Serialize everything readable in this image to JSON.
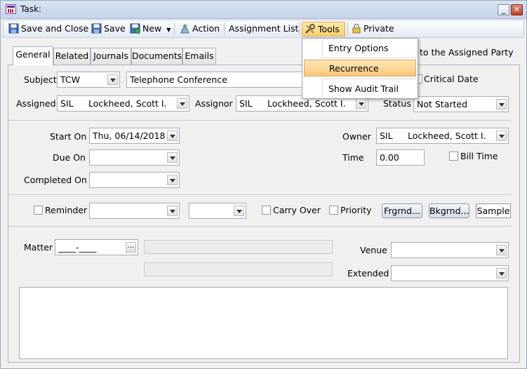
{
  "window": {
    "title": "Task:"
  },
  "toolbar": {
    "save_close": "Save and Close",
    "save": "Save",
    "new": "New",
    "action": "Action",
    "assignment_list": "Assignment List",
    "tools": "Tools",
    "private": "Private"
  },
  "tools_menu": {
    "items": [
      {
        "label": "Entry Options",
        "highlighted": false
      },
      {
        "label": "Recurrence",
        "highlighted": true
      },
      {
        "label": "Show Audit Trail",
        "highlighted": false
      }
    ]
  },
  "tabs": [
    {
      "label": "General",
      "active": true
    },
    {
      "label": "Related",
      "active": false
    },
    {
      "label": "Journals",
      "active": false
    },
    {
      "label": "Documents",
      "active": false
    },
    {
      "label": "Emails",
      "active": false
    }
  ],
  "general": {
    "assigned_party_text": "to the Assigned Party",
    "subject_label": "Subject",
    "subject_code": "TCW",
    "subject_text": "Telephone Conference",
    "critical_date_label": "Critical Date",
    "assigned_label": "Assigned",
    "assigned_code": "SIL",
    "assigned_name": "Lockheed, Scott I.",
    "assignor_label": "Assignor",
    "assignor_code": "SIL",
    "assignor_name": "Lockheed, Scott I.",
    "status_label": "Status",
    "status_value": "Not Started",
    "start_on_label": "Start On",
    "start_on_value": "Thu, 06/14/2018",
    "due_on_label": "Due On",
    "due_on_value": "",
    "completed_on_label": "Completed On",
    "completed_on_value": "",
    "owner_label": "Owner",
    "owner_code": "SIL",
    "owner_name": "Lockheed, Scott I.",
    "time_label": "Time",
    "time_value": "0.00",
    "bill_time_label": "Bill Time",
    "reminder_label": "Reminder",
    "carry_over_label": "Carry Over",
    "priority_label": "Priority",
    "frgrnd_label": "Frgrnd...",
    "bkgrnd_label": "Bkgrnd...",
    "sample_label": "Sample",
    "matter_label": "Matter",
    "matter_value": "____-____",
    "venue_label": "Venue",
    "venue_value": "",
    "extended_label": "Extended",
    "extended_value": ""
  },
  "colors": {
    "menu_highlight": "#f8c77a",
    "title_bar": "#c6d5ea"
  }
}
